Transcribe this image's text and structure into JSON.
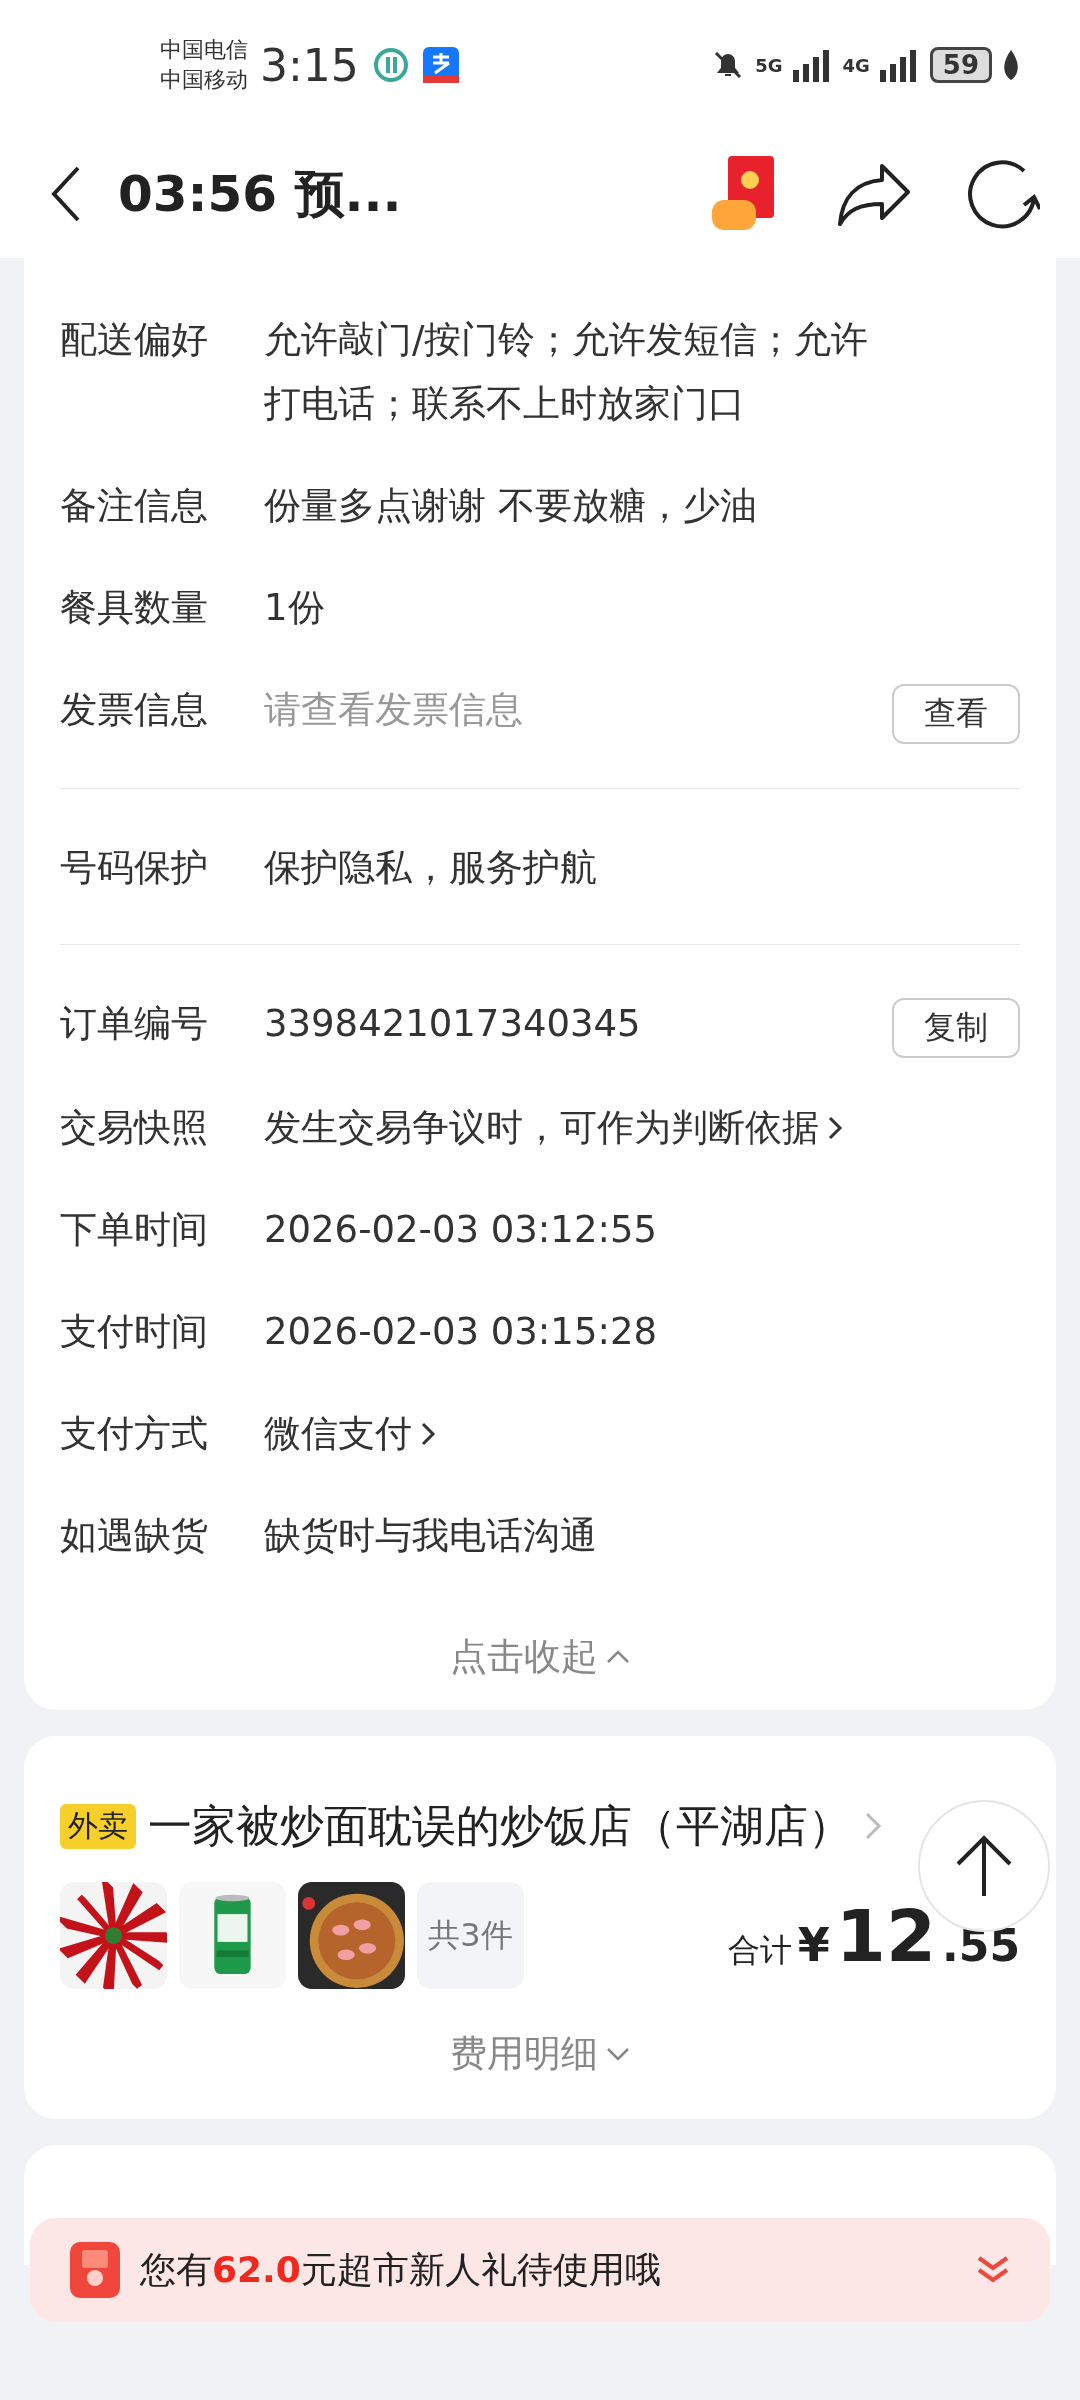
{
  "status_bar": {
    "carriers": [
      "中国电信",
      "中国移动"
    ],
    "time": "3:15",
    "network": [
      "5G",
      "4G"
    ],
    "battery": "59"
  },
  "header": {
    "title": "03:56 预..."
  },
  "details": {
    "sections": [
      [
        {
          "label": "配送偏好",
          "value": "允许敲门/按门铃；允许发短信；允许打电话；联系不上时放家门口",
          "kind": "text"
        },
        {
          "label": "备注信息",
          "value": "份量多点谢谢 不要放糖，少油",
          "kind": "text"
        },
        {
          "label": "餐具数量",
          "value": "1份",
          "kind": "text"
        },
        {
          "label": "发票信息",
          "value": "请查看发票信息",
          "kind": "placeholder",
          "action": "查看"
        }
      ],
      [
        {
          "label": "号码保护",
          "value": "保护隐私，服务护航",
          "kind": "text"
        }
      ],
      [
        {
          "label": "订单编号",
          "value": "3398421017340345",
          "kind": "text",
          "action": "复制"
        },
        {
          "label": "交易快照",
          "value": "发生交易争议时，可作为判断依据",
          "kind": "link"
        },
        {
          "label": "下单时间",
          "value": "2026-02-03 03:12:55",
          "kind": "text"
        },
        {
          "label": "支付时间",
          "value": "2026-02-03 03:15:28",
          "kind": "text"
        },
        {
          "label": "支付方式",
          "value": "微信支付",
          "kind": "link"
        },
        {
          "label": "如遇缺货",
          "value": "缺货时与我电话沟通",
          "kind": "text"
        }
      ]
    ],
    "collapse": "点击收起"
  },
  "order": {
    "tag": "外卖",
    "store": "一家被炒面耽误的炒饭店（平湖店）",
    "count": "共3件",
    "total_label": "合计",
    "currency": "¥",
    "total_int": "12",
    "total_dec": ".55",
    "fee_detail": "费用明细"
  },
  "banner": {
    "text": "您有**62.0**元超市新人礼待使用哦"
  }
}
